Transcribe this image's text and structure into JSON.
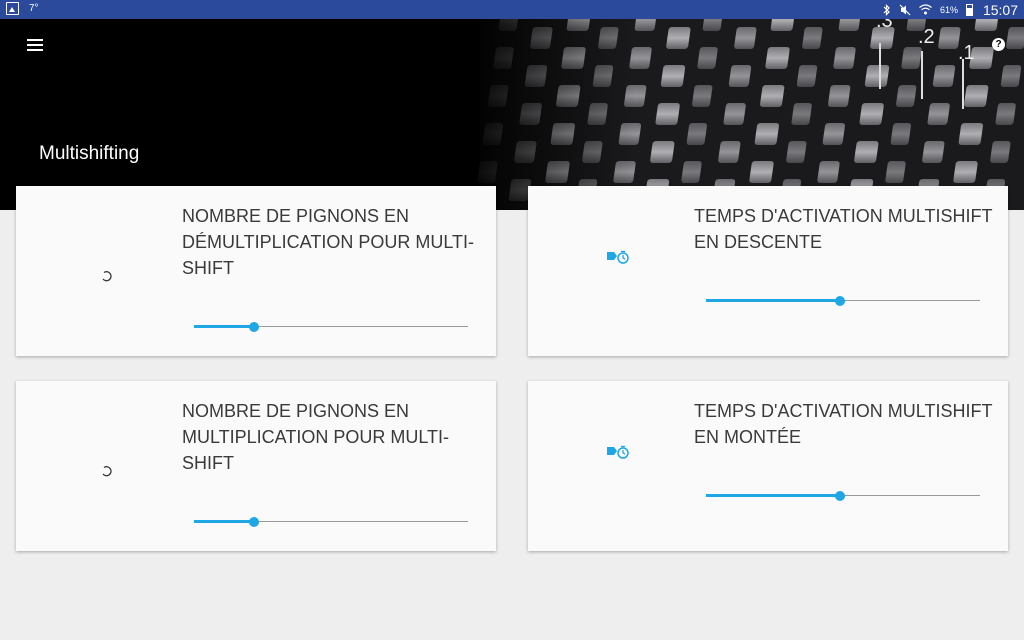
{
  "status_bar": {
    "temperature": "7°",
    "battery_percent": "61%",
    "time": "15:07"
  },
  "header": {
    "title": "Multishifting",
    "gear_labels": [
      ".3",
      ".2",
      ".1"
    ]
  },
  "cards": [
    {
      "title": "NOMBRE DE PIGNONS EN DÉMULTIPLICATION POUR MULTI-SHIFT",
      "icon": "refresh-icon",
      "slider_fraction": 0.22
    },
    {
      "title": "TEMPS D'ACTIVATION MULTISHIFT EN DESCENTE",
      "icon": "shift-timer-icon",
      "slider_fraction": 0.49
    },
    {
      "title": "NOMBRE DE PIGNONS EN MULTIPLICATION POUR MULTI-SHIFT",
      "icon": "refresh-icon",
      "slider_fraction": 0.22
    },
    {
      "title": "TEMPS D'ACTIVATION MULTISHIFT EN MONTÉE",
      "icon": "shift-timer-icon",
      "slider_fraction": 0.49
    }
  ],
  "colors": {
    "status_bar": "#2c4a9c",
    "accent": "#1ea7e4",
    "header_bg": "#000000",
    "background": "#eeeeee",
    "card_bg": "#fafafa"
  }
}
